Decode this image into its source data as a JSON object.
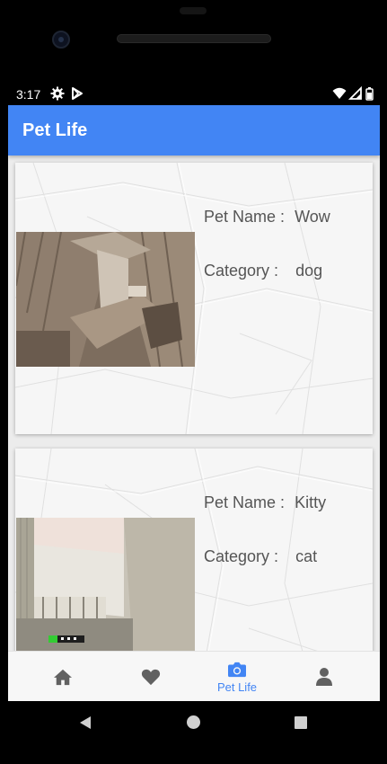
{
  "status_bar": {
    "time": "3:17",
    "icons": [
      "gear-icon",
      "play-store-icon",
      "wifi-icon",
      "signal-icon",
      "battery-icon"
    ]
  },
  "app_bar": {
    "title": "Pet Life",
    "color": "#4285f4"
  },
  "pets": [
    {
      "name_label": "Pet Name :",
      "name": "Wow",
      "category_label": "Category :",
      "category": "dog",
      "photo": "sepia-room-photo"
    },
    {
      "name_label": "Pet Name :",
      "name": "Kitty",
      "category_label": "Category :",
      "category": "cat",
      "photo": "room-window-photo"
    }
  ],
  "bottom_nav": {
    "items": [
      {
        "icon": "home-icon",
        "label": ""
      },
      {
        "icon": "heart-icon",
        "label": ""
      },
      {
        "icon": "camera-icon",
        "label": "Pet Life",
        "active": true
      },
      {
        "icon": "person-icon",
        "label": ""
      }
    ],
    "active_color": "#4285f4",
    "inactive_color": "#616161"
  },
  "system_nav": {
    "buttons": [
      "back-icon",
      "home-circle-icon",
      "recents-square-icon"
    ]
  }
}
